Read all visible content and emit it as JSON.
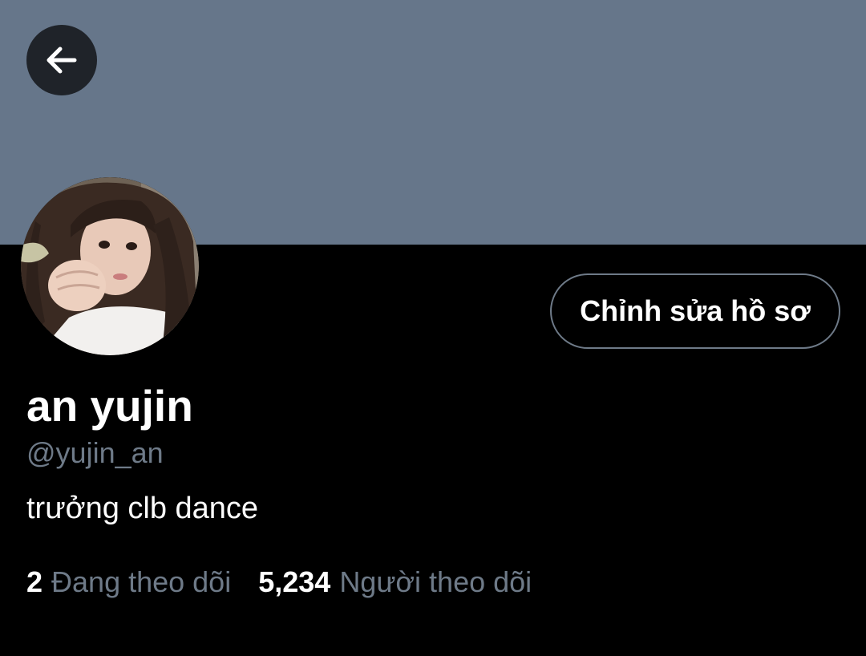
{
  "header": {
    "banner_color": "#66768a",
    "back_icon": "arrow-left-icon"
  },
  "profile": {
    "avatar_icon": "profile-photo",
    "edit_button_label": "Chỉnh sửa hồ sơ",
    "display_name": "an yujin",
    "handle": "@yujin_an",
    "bio": "trưởng clb dance"
  },
  "stats": {
    "following_count": "2",
    "following_label": "Đang theo dõi",
    "followers_count": "5,234",
    "followers_label": "Người theo dõi"
  },
  "colors": {
    "background": "#000000",
    "text_primary": "#ffffff",
    "text_secondary": "#6e7a88",
    "button_border": "#6e7a88"
  }
}
